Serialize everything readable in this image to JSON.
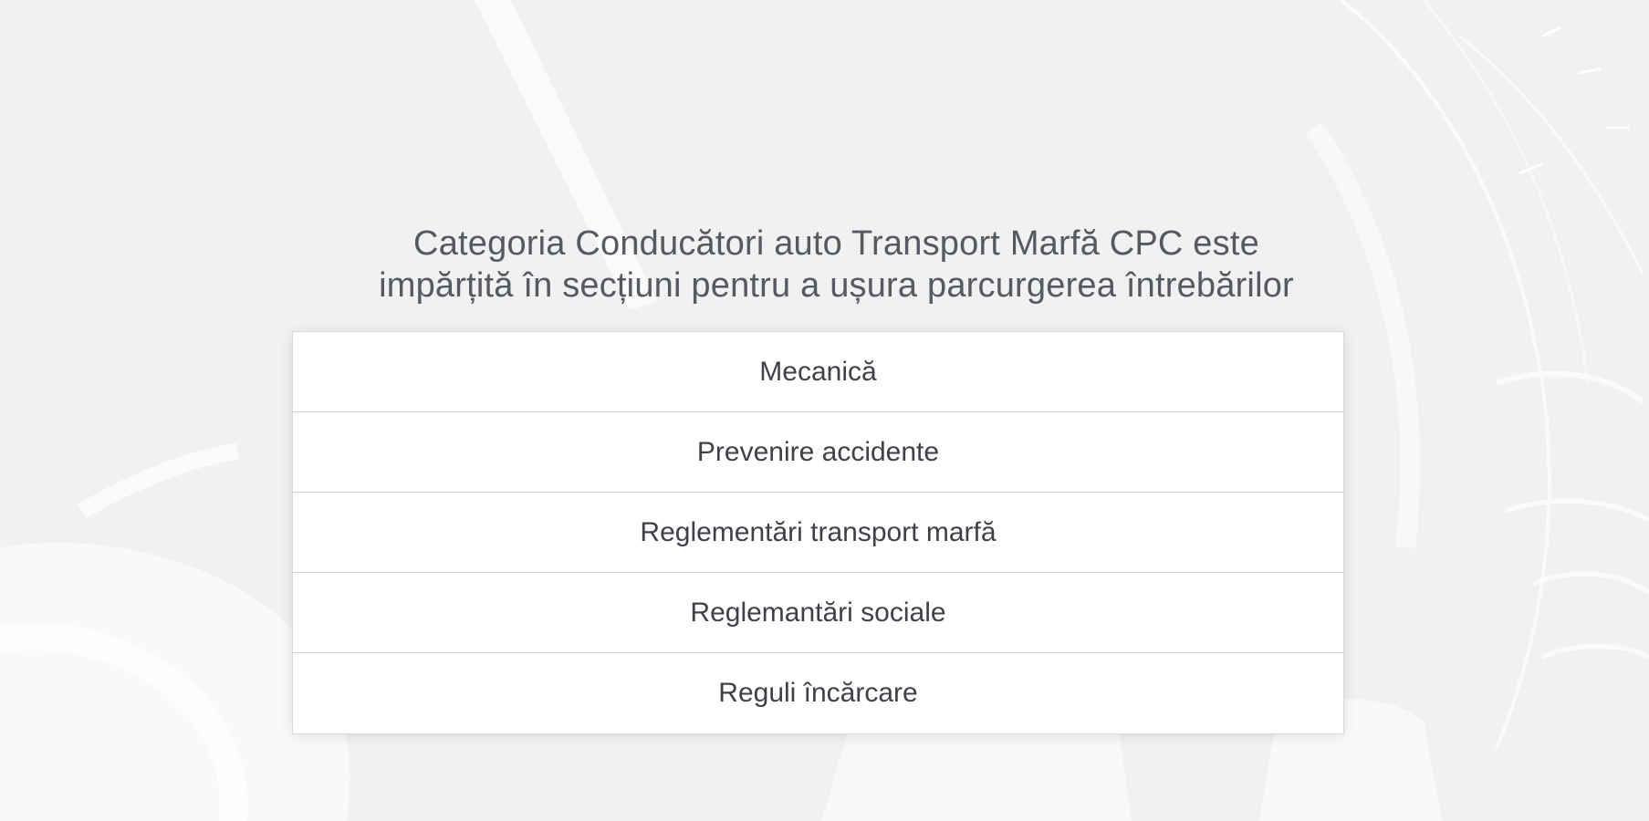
{
  "intro": {
    "line1": "Categoria Conducători auto Transport Marfă CPC este",
    "line2": "impărțită în secțiuni pentru a ușura parcurgerea întrebărilor"
  },
  "sections": [
    {
      "label": "Mecanică"
    },
    {
      "label": "Prevenire accidente"
    },
    {
      "label": "Reglementări transport marfă"
    },
    {
      "label": "Reglemantări sociale"
    },
    {
      "label": "Reguli încărcare"
    }
  ],
  "colors": {
    "page_background": "#f2f2f2",
    "heading_text": "#555a60",
    "item_text": "#3e4148",
    "item_background": "#ffffff",
    "item_border": "#d6d6d6"
  }
}
